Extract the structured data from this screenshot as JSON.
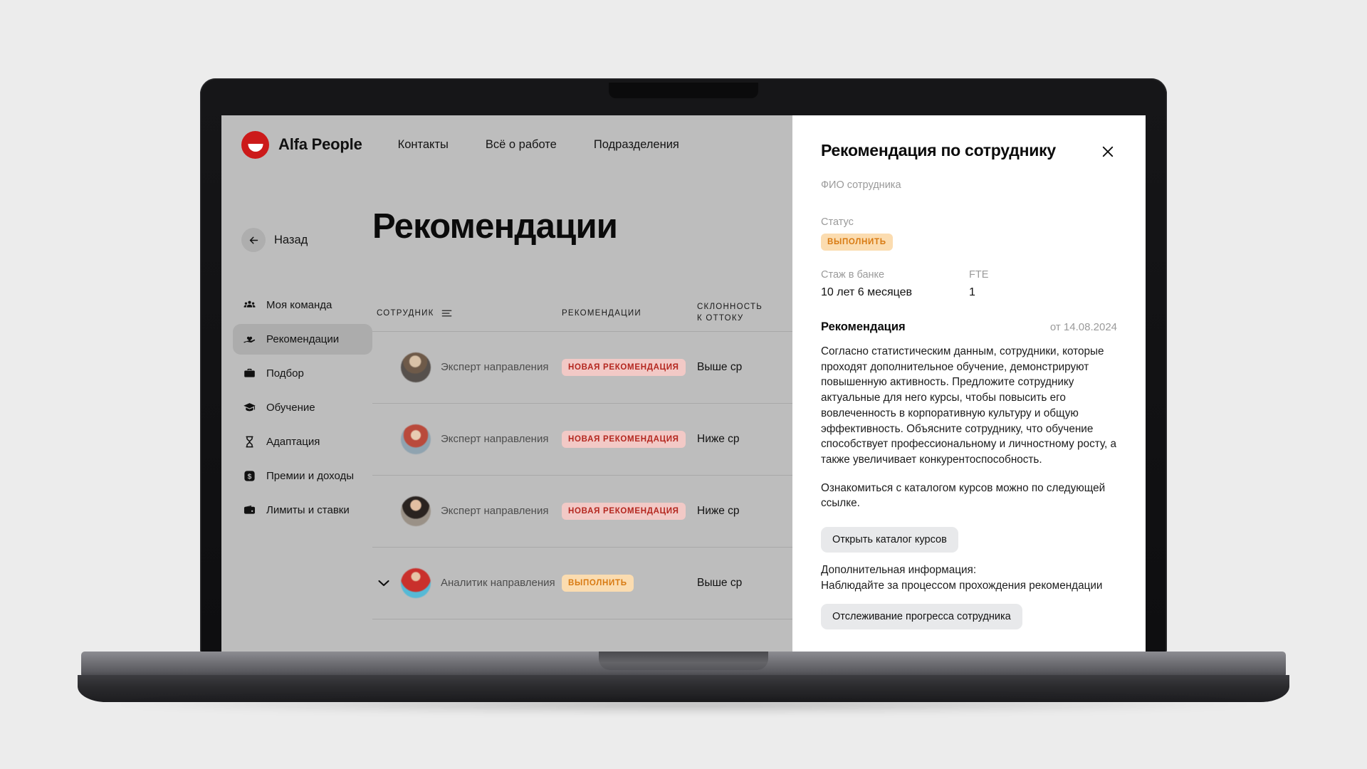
{
  "brand": {
    "name": "Alfa People",
    "logo_icon": "alfa-smile-logo",
    "accent": "#cc1a1a"
  },
  "topnav": {
    "links": [
      {
        "label": "Контакты"
      },
      {
        "label": "Всё о работе"
      },
      {
        "label": "Подразделения"
      }
    ]
  },
  "page": {
    "back_label": "Назад",
    "back_icon": "arrow-left-icon",
    "title": "Рекомендации"
  },
  "sidebar": {
    "items": [
      {
        "label": "Моя команда",
        "icon": "people-group-icon",
        "active": false
      },
      {
        "label": "Рекомендации",
        "icon": "hand-heart-icon",
        "active": true
      },
      {
        "label": "Подбор",
        "icon": "briefcase-icon",
        "active": false
      },
      {
        "label": "Обучение",
        "icon": "graduation-cap-icon",
        "active": false
      },
      {
        "label": "Адаптация",
        "icon": "hourglass-icon",
        "active": false
      },
      {
        "label": "Премии и доходы",
        "icon": "dollar-badge-icon",
        "active": false
      },
      {
        "label": "Лимиты и ставки",
        "icon": "wallet-icon",
        "active": false
      }
    ]
  },
  "table": {
    "columns": [
      {
        "key": "employee",
        "label": "Сотрудник",
        "sort_icon": "sort-lines-icon"
      },
      {
        "key": "recommendation",
        "label": "Рекомендации"
      },
      {
        "key": "churn",
        "label_line1": "Склонность",
        "label_line2": "к оттоку"
      }
    ],
    "rows": [
      {
        "avatar": "avatar-photo-1",
        "name_redacted": true,
        "role": "Эксперт направления",
        "badge": {
          "text": "Новая рекомендация",
          "kind": "new"
        },
        "churn": "Выше ср"
      },
      {
        "avatar": "avatar-photo-2",
        "name_redacted": true,
        "role": "Эксперт направления",
        "badge": {
          "text": "Новая рекомендация",
          "kind": "new"
        },
        "churn": "Ниже ср"
      },
      {
        "avatar": "avatar-photo-3",
        "name_redacted": true,
        "role": "Эксперт направления",
        "badge": {
          "text": "Новая рекомендация",
          "kind": "new"
        },
        "churn": "Ниже ср"
      },
      {
        "avatar": "avatar-photo-4",
        "name_redacted": true,
        "role": "Аналитик направления",
        "badge": {
          "text": "Выполнить",
          "kind": "todo"
        },
        "churn": "Выше ср",
        "expanded_chevron": true
      }
    ]
  },
  "panel": {
    "title": "Рекомендация по сотруднику",
    "close_icon": "close-icon",
    "fio_label": "ФИО сотрудника",
    "status_label": "Статус",
    "status_value": "выполнить",
    "tenure_label": "Стаж в банке",
    "tenure_value": "10 лет 6 месяцев",
    "fte_label": "FTE",
    "fte_value": "1",
    "rec_heading": "Рекомендация",
    "rec_date": "от 14.08.2024",
    "rec_paragraph_1": "Согласно статистическим данным, сотрудники, которые проходят дополнительное обучение, демонстрируют повышенную активность. Предложите сотруднику актуальные для него курсы, чтобы повысить его вовлеченность в корпоративную культуру и общую эффективность. Объясните сотруднику, что обучение способствует профессиональному и личностному росту, а также увеличивает конкурентоспособность.",
    "rec_paragraph_2": "Ознакомиться с каталогом курсов можно по следующей ссылке.",
    "catalog_button": "Открыть каталог курсов",
    "extra_label": "Дополнительная информация:",
    "extra_text": "Наблюдайте за процессом прохождения рекомендации",
    "progress_button": "Отслеживание прогресса сотрудника",
    "colors": {
      "status_badge_bg": "#fbdcb0",
      "status_badge_fg": "#d87a12",
      "new_badge_bg": "#f2c9c6",
      "new_badge_fg": "#b4271f"
    }
  }
}
